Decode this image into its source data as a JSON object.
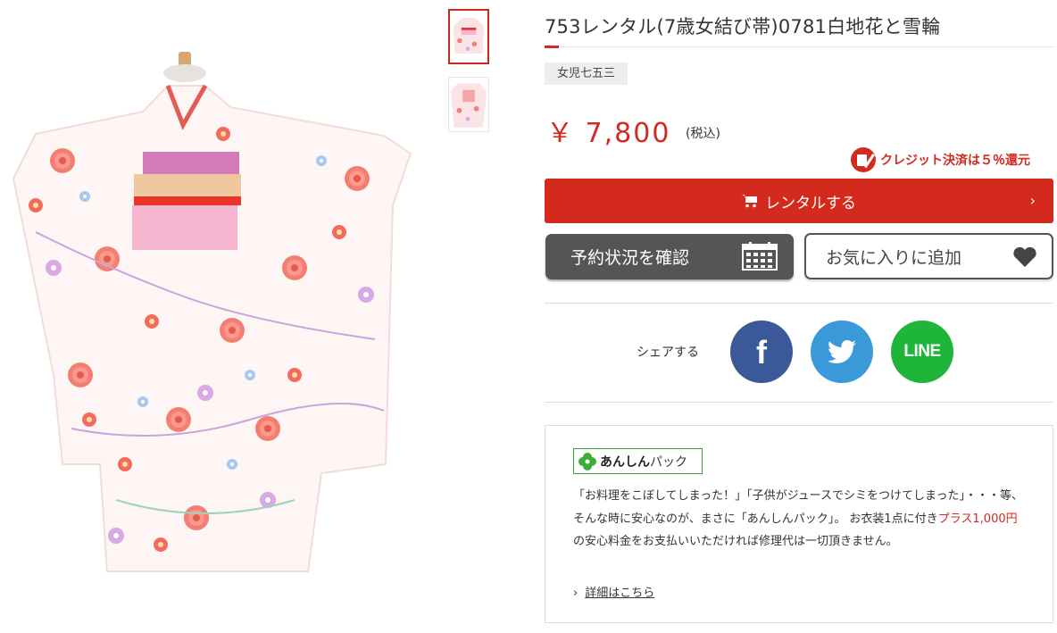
{
  "product": {
    "title": "753レンタル(7歳女結び帯)0781白地花と雪輪",
    "category_tag": "女児七五三",
    "price": "￥ 7,800",
    "tax_note": "(税込)",
    "credit_badge": "クレジット決済は５％還元"
  },
  "gallery": {
    "main_image_icon": "kimono-photo",
    "thumbnails": [
      {
        "icon": "kimono-front-thumbnail",
        "active": true
      },
      {
        "icon": "kimono-back-thumbnail",
        "active": false
      }
    ]
  },
  "actions": {
    "rent_label": "レンタルする",
    "rent_chevron": "›",
    "reserve_label": "予約状況を確認",
    "favorite_label": "お気に入りに追加"
  },
  "share": {
    "label": "シェアする",
    "facebook_glyph": "f",
    "line_label": "LINE"
  },
  "anshin": {
    "logo_strong": "あんしん",
    "logo_suffix": "パック",
    "text_before": "「お料理をこぼしてしまった！」「子供がジュースでシミをつけてしまった」・・・等、そんな時に安心なのが、まさに「あんしんパック」。 お衣装1点に付き",
    "text_highlight": "プラス1,000円",
    "text_after": "の安心料金をお支払いいただければ修理代は一切頂きません。",
    "link_arrow": "›",
    "link_label": "詳細はこちら"
  },
  "colors": {
    "brand_red": "#d42a1e",
    "dark_button": "#555555",
    "facebook": "#3b5998",
    "twitter": "#3a9ad9",
    "line": "#1eb53a",
    "anshin_green": "#2fa82f"
  }
}
